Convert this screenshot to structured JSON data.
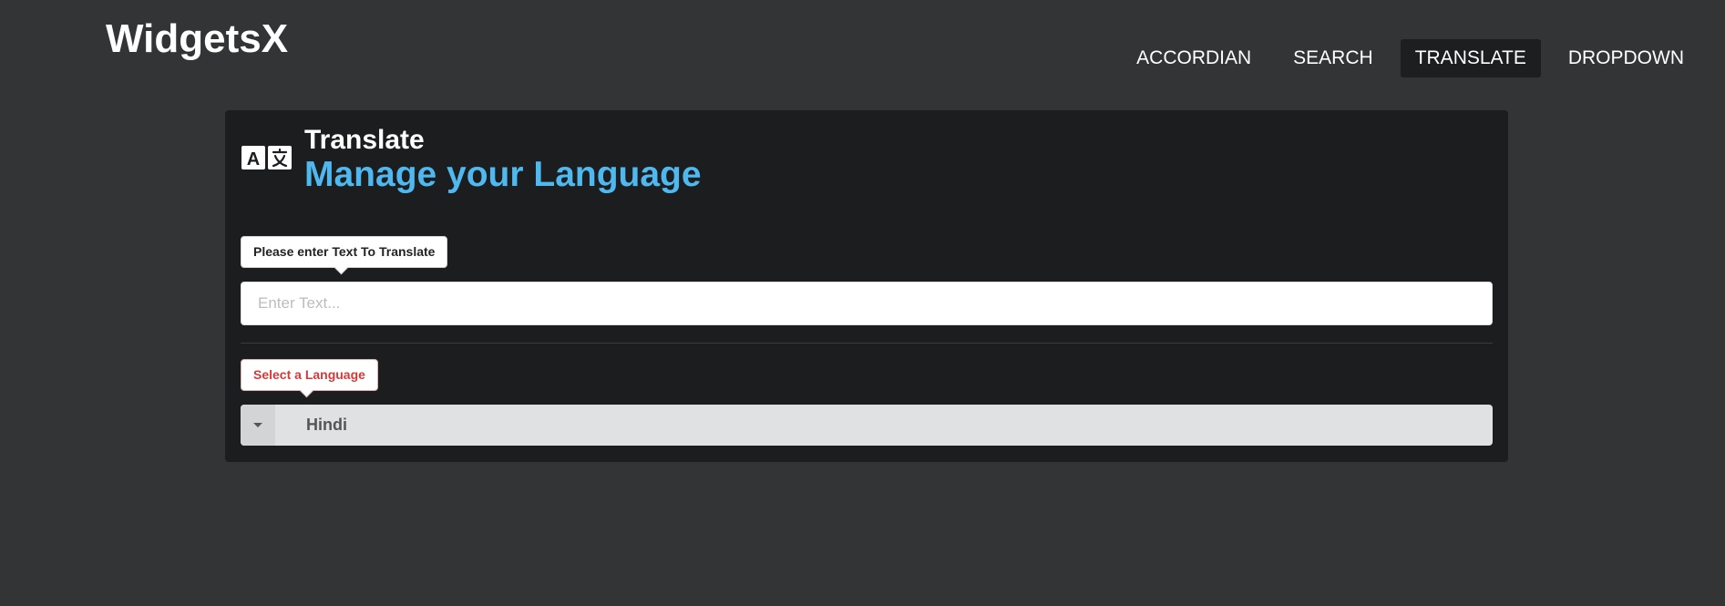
{
  "brand": {
    "name": "WidgetsX"
  },
  "nav": {
    "items": [
      {
        "label": "ACCORDIAN"
      },
      {
        "label": "SEARCH"
      },
      {
        "label": "TRANSLATE"
      },
      {
        "label": "DROPDOWN"
      }
    ],
    "active": "TRANSLATE"
  },
  "translate": {
    "icon": "translate-icon",
    "title": "Translate",
    "subtitle": "Manage your Language",
    "input_tip": "Please enter Text To Translate",
    "input_placeholder": "Enter Text...",
    "input_value": "",
    "select_tip": "Select a Language",
    "selected_language": "Hindi"
  },
  "colors": {
    "background": "#333436",
    "card": "#1c1d1f",
    "accent": "#4fb8ee",
    "error_text": "#d43a3a"
  }
}
